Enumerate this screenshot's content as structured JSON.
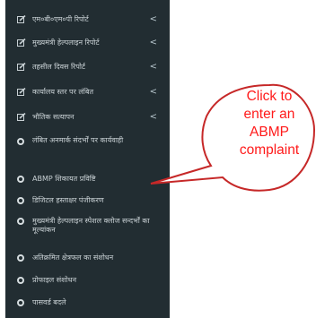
{
  "sidebar": {
    "items": [
      {
        "label": "एम०बी०एम०पी रिपोर्ट",
        "icon": "edit-icon",
        "chevron": "<"
      },
      {
        "label": "मुख्यमंत्री हेल्पलाइन रिपोर्ट",
        "icon": "edit-icon",
        "chevron": "<"
      },
      {
        "label": "तहसील दिवस रिपोर्ट",
        "icon": "edit-icon",
        "chevron": "<"
      },
      {
        "label": "कार्यालय स्तर पर लंबित",
        "icon": "edit-icon",
        "chevron": "<"
      },
      {
        "label": "भौतिक सत्यापन",
        "icon": "edit-icon",
        "chevron": "<"
      },
      {
        "label": "लंबित अनमार्क संदर्भों पर कार्यवाही",
        "icon": "circle-icon"
      },
      {
        "label": "ABMP शिकायत प्रविष्टि",
        "icon": "circle-icon"
      },
      {
        "label": "डिजिटल हस्ताक्षर पंजीकरण",
        "icon": "circle-icon"
      },
      {
        "label": "मुख्यमंत्री हेल्पलाइन स्पेशल क्लोज सन्दर्भों का मूल्यांकन",
        "icon": "circle-icon"
      },
      {
        "label": "अतिक्रमित क्षेत्रफल का संशोधन",
        "icon": "circle-icon"
      },
      {
        "label": "प्रोफाइल संशोधन",
        "icon": "circle-icon"
      },
      {
        "label": "पासवर्ड बदले",
        "icon": "circle-icon"
      }
    ]
  },
  "callout": {
    "lines": [
      "Click to",
      "enter an",
      "ABMP",
      "complaint"
    ],
    "color": "#ff1a1a"
  },
  "colors": {
    "sidebar_bg": "#222d32",
    "text": "#c8d0d4"
  }
}
